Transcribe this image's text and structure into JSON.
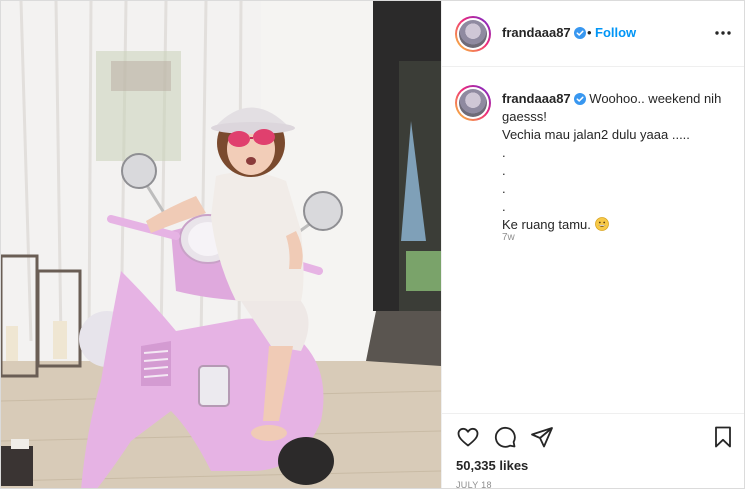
{
  "post": {
    "username": "frandaaa87",
    "verified": true,
    "follow_label": "Follow",
    "dot": "•",
    "caption": {
      "username": "frandaaa87",
      "lines": [
        "Woohoo.. weekend nih gaesss!",
        "Vechia mau jalan2 dulu yaaa .....",
        ".",
        ".",
        ".",
        ".",
        "Ke ruang tamu."
      ],
      "emoji": "grinning-face-emoji",
      "time_ago": "7w"
    },
    "likes": "50,335 likes",
    "date": "JULY 18"
  },
  "icons": {
    "more": "more-options-icon",
    "like": "heart-icon",
    "comment": "comment-icon",
    "share": "paper-plane-icon",
    "save": "bookmark-icon",
    "verified": "verified-badge-icon"
  },
  "colors": {
    "follow": "#0095f6",
    "verified": "#3897f0",
    "scooter": "#e8b4e6",
    "border": "#dbdbdb"
  }
}
